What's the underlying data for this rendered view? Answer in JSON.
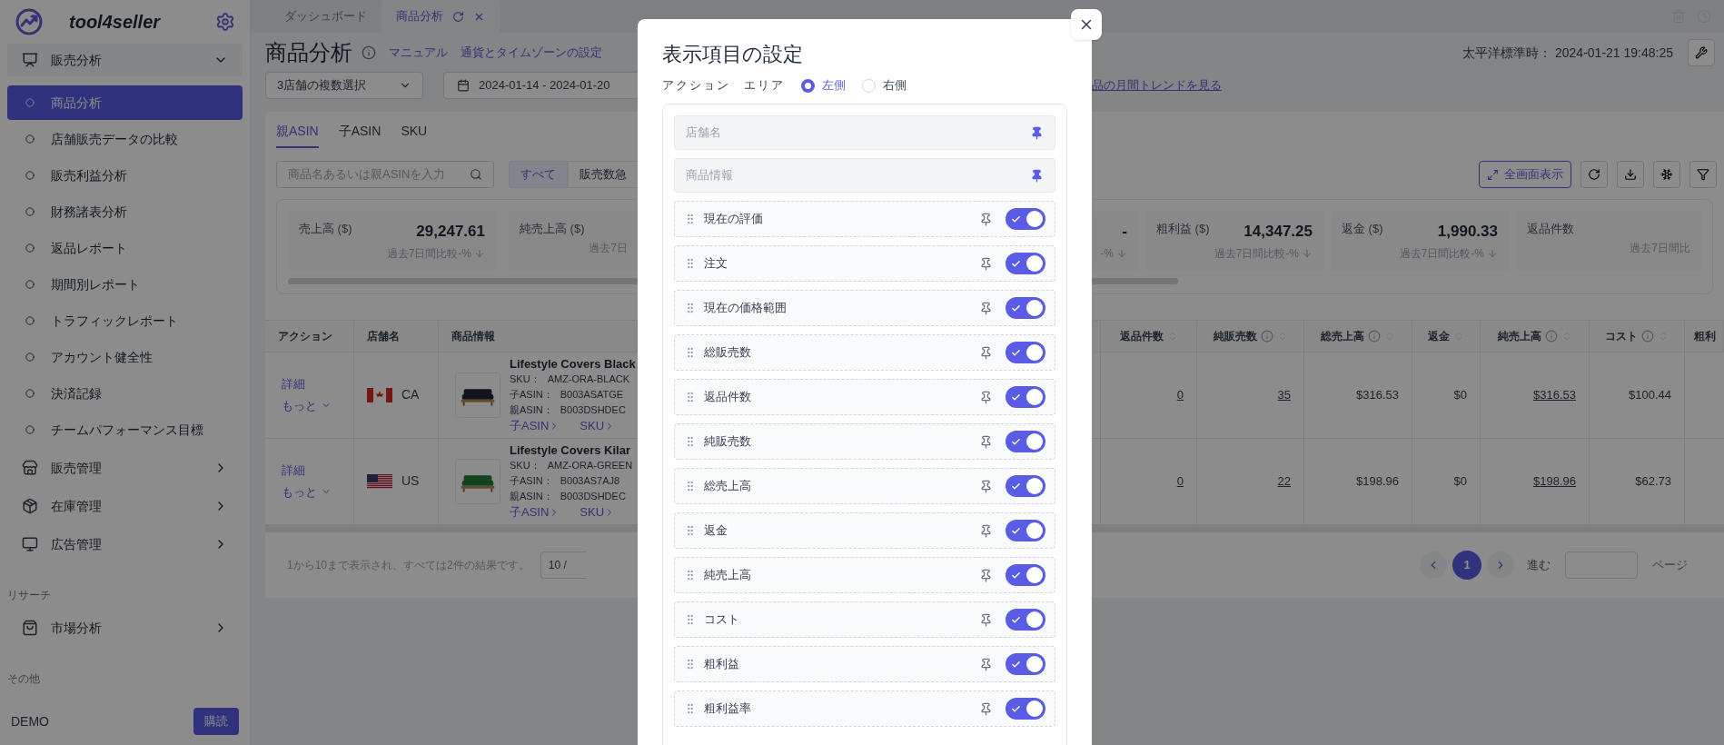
{
  "sidebar": {
    "brand": "tool4seller",
    "nav": [
      {
        "kind": "group",
        "label": "販売分析",
        "expanded": true,
        "children": [
          {
            "label": "商品分析",
            "selected": true
          },
          {
            "label": "店舗販売データの比較",
            "selected": false
          },
          {
            "label": "販売利益分析",
            "selected": false
          },
          {
            "label": "財務諸表分析",
            "selected": false
          },
          {
            "label": "返品レポート",
            "selected": false
          },
          {
            "label": "期間別レポート",
            "selected": false
          },
          {
            "label": "トラフィックレポート",
            "selected": false
          },
          {
            "label": "アカウント健全性",
            "selected": false
          },
          {
            "label": "決済記録",
            "selected": false
          },
          {
            "label": "チームパフォーマンス目標",
            "selected": false
          }
        ]
      },
      {
        "kind": "group",
        "label": "販売管理",
        "expanded": false
      },
      {
        "kind": "group",
        "label": "在庫管理",
        "expanded": false
      },
      {
        "kind": "group",
        "label": "広告管理",
        "expanded": false
      },
      {
        "kind": "section",
        "label": "リサーチ"
      },
      {
        "kind": "group",
        "label": "市場分析",
        "expanded": false
      },
      {
        "kind": "section",
        "label": "その他"
      }
    ],
    "user": "DEMO",
    "subscribe_button": "購読"
  },
  "tabs": [
    {
      "label": "ダッシュボード",
      "selected": false
    },
    {
      "label": "商品分析",
      "selected": true
    }
  ],
  "header": {
    "title": "商品分析",
    "links": [
      "マニュアル",
      "通貨とタイムゾーンの設定"
    ],
    "timezone": "太平洋標準時： 2024-01-21 19:48:25"
  },
  "filters": {
    "store_select": "3店舗の複数選択",
    "date_range": "2024-01-14 - 2024-01-20",
    "trend_link": "品の月間トレンドを見る"
  },
  "view_tabs": [
    {
      "label": "親ASIN",
      "selected": true
    },
    {
      "label": "子ASIN",
      "selected": false
    },
    {
      "label": "SKU",
      "selected": false
    }
  ],
  "search": {
    "placeholder": "商品名あるいは親ASINを入力"
  },
  "segments": [
    {
      "label": "すべて",
      "selected": true
    },
    {
      "label": "販売数急",
      "selected": false
    }
  ],
  "fullscreen_button": "全画面表示",
  "stats": {
    "left": [
      {
        "label": "売上高 ($)",
        "value": "29,247.61",
        "compare": "過去7日間比較-%",
        "declining": true
      },
      {
        "label": "純売上高 ($)",
        "compare": "過去7日"
      }
    ],
    "right": [
      {
        "value": "-",
        "compare": "-%",
        "declining": true
      },
      {
        "label": "粗利益 ($)",
        "value": "14,347.25",
        "compare": "過去7日間比較-%",
        "declining": true
      },
      {
        "label": "返金 ($)",
        "value": "1,990.33",
        "compare": "過去7日間比較-%",
        "declining": true
      },
      {
        "label": "返品件数",
        "compare": "過去7日間比"
      }
    ]
  },
  "table": {
    "left_columns": [
      "アクション",
      "店舗名",
      "商品情報"
    ],
    "right_columns": [
      {
        "label": "返品件数",
        "info": false,
        "sortable": true
      },
      {
        "label": "純販売数",
        "info": true,
        "sortable": true
      },
      {
        "label": "総売上高",
        "info": true,
        "sortable": true
      },
      {
        "label": "返金",
        "info": false,
        "sortable": true
      },
      {
        "label": "純売上高",
        "info": true,
        "sortable": true
      },
      {
        "label": "コスト",
        "info": true,
        "sortable": true
      },
      {
        "label": "粗利"
      }
    ],
    "rows": [
      {
        "actions": [
          "詳細",
          "もっと"
        ],
        "store": {
          "kind": "canada",
          "code": "CA"
        },
        "product": {
          "name": "Lifestyle Covers Black",
          "details": [
            {
              "label": "SKU：",
              "value": "AMZ-ORA-BLACK"
            },
            {
              "label": "子ASIN：",
              "value": "B003ASATGE"
            },
            {
              "label": "親ASIN：",
              "value": "B003DSHDEC"
            }
          ],
          "links": [
            "子ASIN",
            "SKU"
          ]
        },
        "cells": [
          {
            "text": "0",
            "link": true
          },
          {
            "text": "35",
            "link": true
          },
          {
            "text": "$316.53",
            "link": false
          },
          {
            "text": "$0",
            "link": false
          },
          {
            "text": "$316.53",
            "link": true
          },
          {
            "text": "$100.44",
            "link": false
          }
        ]
      },
      {
        "actions": [
          "詳細",
          "もっと"
        ],
        "store": {
          "kind": "usa",
          "code": "US"
        },
        "product": {
          "name": "Lifestyle Covers Kilar",
          "details": [
            {
              "label": "SKU：",
              "value": "AMZ-ORA-GREEN"
            },
            {
              "label": "子ASIN：",
              "value": "B003AS7AJ8"
            },
            {
              "label": "親ASIN：",
              "value": "B003DSHDEC"
            }
          ],
          "links": [
            "子ASIN",
            "SKU"
          ]
        },
        "cells": [
          {
            "text": "0",
            "link": true
          },
          {
            "text": "22",
            "link": true
          },
          {
            "text": "$198.96",
            "link": false
          },
          {
            "text": "$0",
            "link": false
          },
          {
            "text": "$198.96",
            "link": true
          },
          {
            "text": "$62.73",
            "link": false
          }
        ]
      }
    ]
  },
  "pagination": {
    "summary": "1から10まで表示され、すべては2件の結果です。",
    "page_size": "10 /",
    "pages": [
      {
        "label": "1",
        "selected": true
      }
    ],
    "goto_label": "進む",
    "page_suffix": "ページ"
  },
  "modal": {
    "title": "表示項目の設定",
    "area_label": "アクション　エリア",
    "radios": [
      {
        "label": "左側",
        "selected": true
      },
      {
        "label": "右側",
        "selected": false
      }
    ],
    "columns": [
      {
        "kind": "fixed",
        "label": "店舗名"
      },
      {
        "kind": "fixed",
        "label": "商品情報"
      },
      {
        "kind": "toggle",
        "label": "現在の評価",
        "on": true
      },
      {
        "kind": "toggle",
        "label": "注文",
        "on": true
      },
      {
        "kind": "toggle",
        "label": "現在の価格範囲",
        "on": true
      },
      {
        "kind": "toggle",
        "label": "総販売数",
        "on": true
      },
      {
        "kind": "toggle",
        "label": "返品件数",
        "on": true
      },
      {
        "kind": "toggle",
        "label": "純販売数",
        "on": true
      },
      {
        "kind": "toggle",
        "label": "総売上高",
        "on": true
      },
      {
        "kind": "toggle",
        "label": "返金",
        "on": true
      },
      {
        "kind": "toggle",
        "label": "純売上高",
        "on": true
      },
      {
        "kind": "toggle",
        "label": "コスト",
        "on": true
      },
      {
        "kind": "toggle",
        "label": "粗利益",
        "on": true
      },
      {
        "kind": "toggle",
        "label": "粗利益率",
        "on": true
      }
    ]
  }
}
